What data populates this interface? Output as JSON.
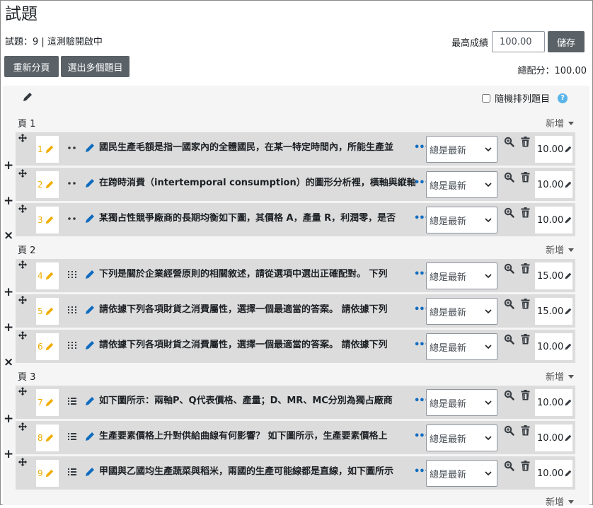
{
  "page": {
    "title": "試題",
    "status": "試題：9 | 這測驗開啟中"
  },
  "header": {
    "max_grade_label": "最高成績",
    "max_grade_value": "100.00",
    "save_label": "儲存",
    "repaginate_label": "重新分頁",
    "select_multiple_label": "選出多個題目",
    "total_marks": "總配分：100.00"
  },
  "options": {
    "shuffle_label": "隨機排列題目",
    "help_icon": "?",
    "shuffle_checked": false
  },
  "add_label": "新增",
  "sections": [
    {
      "heading": "頁 1",
      "slots": [
        {
          "num": "1",
          "type_icon": "dots-icon",
          "text": "國民生產毛額是指一國家內的全體國民，在某一特定時間內，所能生產並",
          "version": "總是最新",
          "mark": "10.00"
        },
        {
          "num": "2",
          "type_icon": "dots-icon",
          "text": "在跨時消費（intertemporal consumption）的圖形分析裡，橫軸與縱軸",
          "version": "總是最新",
          "mark": "10.00"
        },
        {
          "num": "3",
          "type_icon": "dots-icon",
          "text": "某獨占性競爭廠商的長期均衡如下圖，其價格 A，產量 R，利潤零，是否",
          "version": "總是最新",
          "mark": "10.00"
        }
      ]
    },
    {
      "heading": "頁 2",
      "slots": [
        {
          "num": "4",
          "type_icon": "grid-icon",
          "text": "下列是關於企業經營原則的相關敘述，請從選項中選出正確配對。 下列",
          "version": "總是最新",
          "mark": "15.00"
        },
        {
          "num": "5",
          "type_icon": "grid-icon",
          "text": "請依據下列各項財貨之消費屬性，選擇一個最適當的答案。 請依據下列",
          "version": "總是最新",
          "mark": "15.00"
        },
        {
          "num": "6",
          "type_icon": "grid-icon",
          "text": "請依據下列各項財貨之消費屬性，選擇一個最適當的答案。 請依據下列",
          "version": "總是最新",
          "mark": "10.00"
        }
      ]
    },
    {
      "heading": "頁 3",
      "slots": [
        {
          "num": "7",
          "type_icon": "list-icon",
          "text": "如下圖所示：兩軸P、Q代表價格、產量；D、MR、MC分別為獨占廠商",
          "version": "總是最新",
          "mark": "10.00"
        },
        {
          "num": "8",
          "type_icon": "list-icon",
          "text": "生產要素價格上升對供給曲線有何影響？ 如下圖所示，生產要素價格上",
          "version": "總是最新",
          "mark": "10.00"
        },
        {
          "num": "9",
          "type_icon": "list-icon",
          "text": "甲國與乙國均生產蔬菜與稻米，兩國的生產可能線都是直線，如下圖所示",
          "version": "總是最新",
          "mark": "10.00"
        }
      ]
    }
  ],
  "page_toggles": [
    "+",
    "+",
    "×",
    "+",
    "+",
    "×",
    "+",
    "+"
  ],
  "ellipsis": "•••",
  "colors": {
    "button_bg": "#5a6268",
    "slot_bg": "#dcdcdc",
    "edit_area_bg": "#f5f5f5",
    "number_yellow": "#f0ad00",
    "link_blue": "#0f6cbf",
    "help_blue": "#59b4e8"
  }
}
